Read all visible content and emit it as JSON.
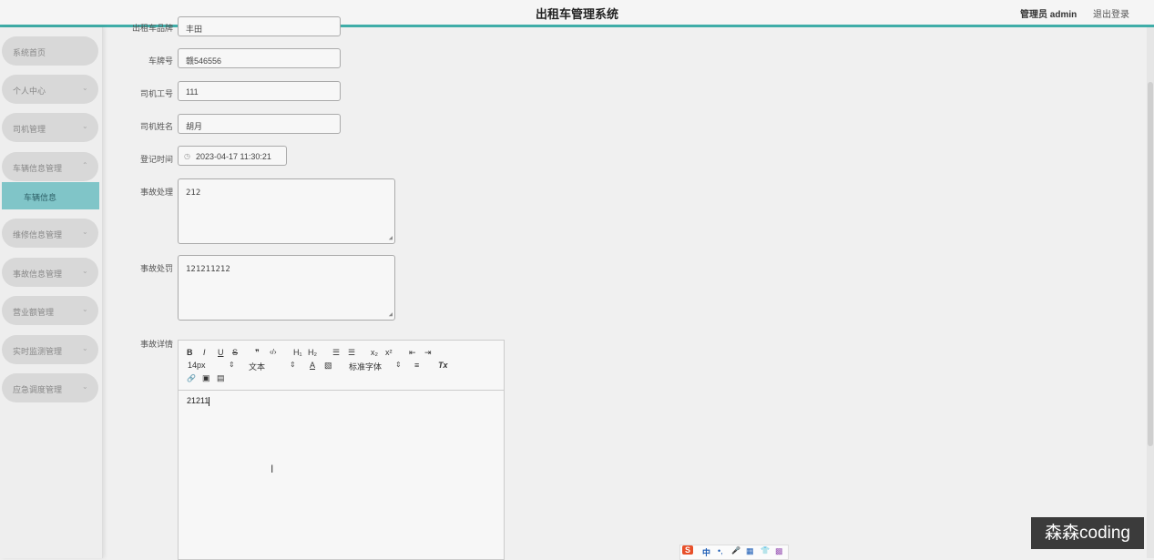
{
  "header": {
    "title": "出租车管理系统",
    "user_label": "管理员 admin",
    "logout_label": "退出登录"
  },
  "sidebar": {
    "items": [
      {
        "label": "系统首页",
        "chevron": ""
      },
      {
        "label": "个人中心",
        "chevron": "⌄"
      },
      {
        "label": "司机管理",
        "chevron": "⌄"
      },
      {
        "label": "车辆信息管理",
        "chevron": "⌃"
      },
      {
        "label": "维修信息管理",
        "chevron": "⌄"
      },
      {
        "label": "事故信息管理",
        "chevron": "⌄"
      },
      {
        "label": "营业额管理",
        "chevron": "⌄"
      },
      {
        "label": "实时监测管理",
        "chevron": "⌄"
      },
      {
        "label": "应急调度管理",
        "chevron": "⌄"
      }
    ],
    "active_subitem": "车辆信息"
  },
  "form": {
    "cut_top": {
      "label": "出租车品牌",
      "value": "丰田"
    },
    "plate": {
      "label": "车牌号",
      "value": "赣546556"
    },
    "driver_id": {
      "label": "司机工号",
      "value": "111"
    },
    "driver_name": {
      "label": "司机姓名",
      "value": "胡月"
    },
    "register_time": {
      "label": "登记时间",
      "value": "2023-04-17 11:30:21"
    },
    "accident_handling": {
      "label": "事故处理",
      "value": "212"
    },
    "accident_penalty": {
      "label": "事故处罚",
      "value": "121211212"
    },
    "accident_details": {
      "label": "事故详情",
      "value": "21211"
    }
  },
  "editor_toolbar": {
    "bold": "B",
    "italic": "I",
    "underline": "U",
    "strike": "S",
    "quote": "❞",
    "code": "‹/›",
    "h1": "H₁",
    "h2": "H₂",
    "ordered_list": "☰",
    "bullet_list": "☰",
    "sub": "x₂",
    "sup": "x²",
    "indent_dec": "⇤",
    "indent_inc": "⇥",
    "size_select": "14px",
    "text_select": "文本",
    "font_color": "A",
    "bg_color": "▧",
    "font_select": "标准字体",
    "align": "≡",
    "clear": "Tx",
    "link": "🔗",
    "image": "▣",
    "video": "▤"
  },
  "ime": {
    "logo": "S",
    "lang": "中",
    "punct": "•,",
    "mic": "🎤",
    "keyboard": "▦",
    "skin": "👕",
    "tools": "▩"
  },
  "watermark": "森森coding"
}
